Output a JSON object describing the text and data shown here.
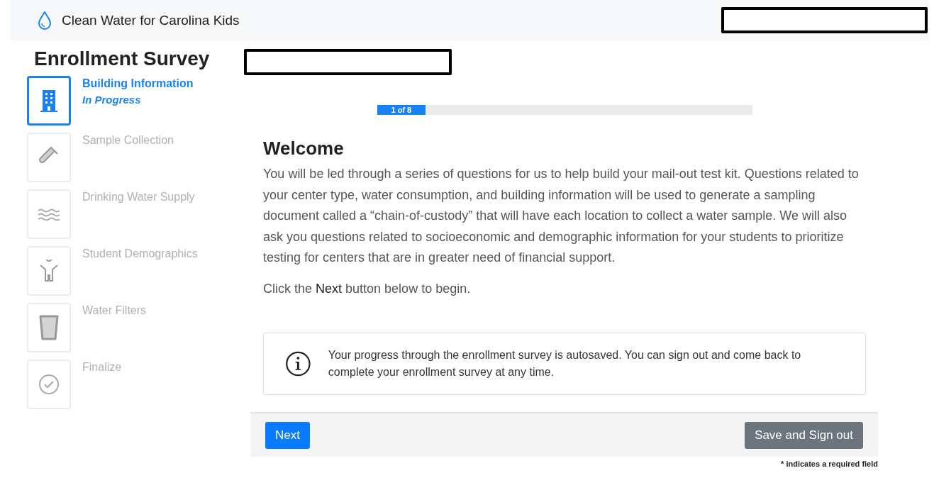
{
  "header": {
    "app_name": "Clean Water for Carolina Kids"
  },
  "sidebar": {
    "title": "Enrollment Survey",
    "steps": [
      {
        "label": "Building Information",
        "status": "In Progress",
        "kind": "building",
        "selected": true
      },
      {
        "label": "Sample Collection",
        "kind": "tube",
        "selected": false
      },
      {
        "label": "Drinking Water Supply",
        "kind": "waves",
        "selected": false
      },
      {
        "label": "Student Demographics",
        "kind": "child",
        "selected": false
      },
      {
        "label": "Water Filters",
        "kind": "glass",
        "selected": false
      },
      {
        "label": "Finalize",
        "kind": "check",
        "selected": false
      }
    ]
  },
  "progress": {
    "label": "1 of 8",
    "level": 0.128
  },
  "content": {
    "heading": "Welcome",
    "paragraph": "You will be led through a series of questions for us to help build your mail-out test kit. Questions related to your center type, water consumption, and building information will be used to generate a sampling document called a “chain-of-custody” that will have each location to collect a water sample. We will also ask you questions related to socioeconomic and demographic information for your students to prioritize testing for centers that are in greater need of financial support.",
    "instruction": "Click the **Next** button below to begin.",
    "notice": "Your progress through the enrollment survey is autosaved. You can sign out and come back to complete your enrollment survey at any time."
  },
  "footer": {
    "buttons": [
      "Next",
      "Save and Sign out"
    ],
    "note": "* indicates a required field"
  }
}
